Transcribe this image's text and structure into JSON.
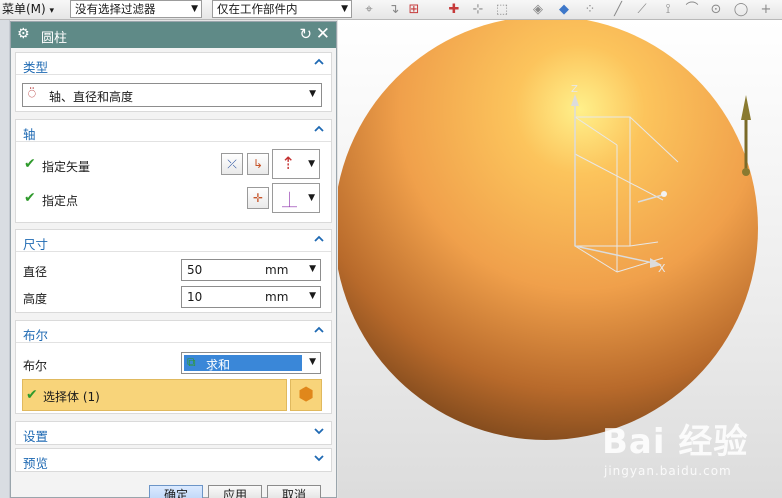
{
  "toolbar": {
    "menu_label": "菜单(M)",
    "filter_select": "没有选择过滤器",
    "scope_select": "仅在工作部件内"
  },
  "dialog": {
    "title": "圆柱",
    "sections": {
      "type": {
        "label": "类型",
        "value": "轴、直径和高度"
      },
      "axis": {
        "label": "轴",
        "vector_label": "指定矢量",
        "point_label": "指定点"
      },
      "size": {
        "label": "尺寸",
        "diameter_label": "直径",
        "diameter_value": "50",
        "diameter_unit": "mm",
        "height_label": "高度",
        "height_value": "10",
        "height_unit": "mm"
      },
      "boolean": {
        "label": "布尔",
        "field_label": "布尔",
        "value": "求和",
        "select_body_label": "选择体 (1)"
      },
      "settings": {
        "label": "设置"
      },
      "preview": {
        "label": "预览"
      }
    },
    "buttons": {
      "ok": "确定",
      "apply": "应用",
      "cancel": "取消"
    }
  },
  "viewport": {
    "axis_labels": {
      "x": "X",
      "z": "Z"
    },
    "sphere_color": "#f3a44a"
  },
  "watermark": {
    "brand": "Bai 经验",
    "site": "jingyan.baidu.com"
  }
}
